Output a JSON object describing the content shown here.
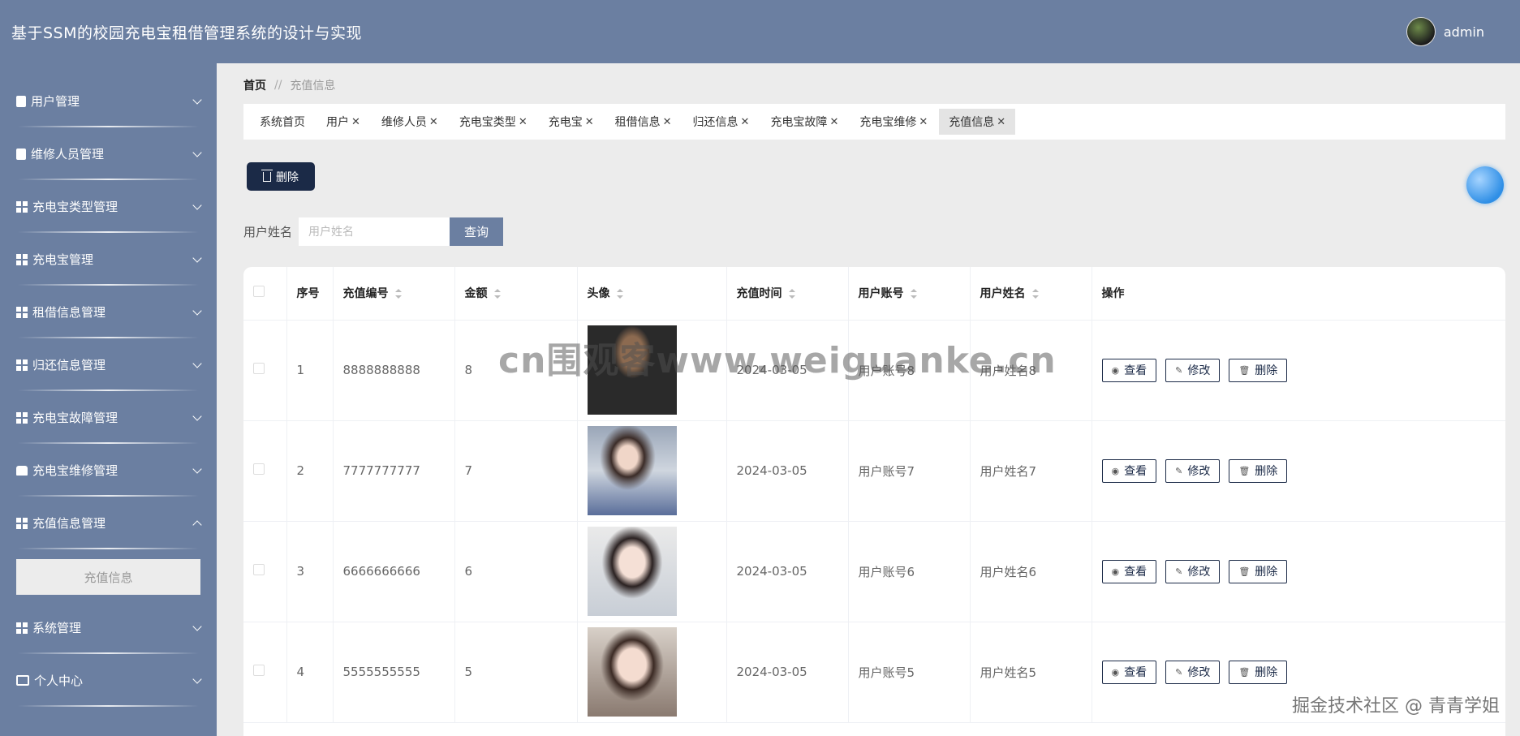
{
  "app": {
    "title": "基于SSM的校园充电宝租借管理系统的设计与实现"
  },
  "user": {
    "name": "admin"
  },
  "sidebar": {
    "items": [
      {
        "label": "用户管理",
        "icon": "clipboard-icon"
      },
      {
        "label": "维修人员管理",
        "icon": "clipboard-check-icon"
      },
      {
        "label": "充电宝类型管理",
        "icon": "grid-icon"
      },
      {
        "label": "充电宝管理",
        "icon": "grid-icon"
      },
      {
        "label": "租借信息管理",
        "icon": "grid-icon"
      },
      {
        "label": "归还信息管理",
        "icon": "grid-icon"
      },
      {
        "label": "充电宝故障管理",
        "icon": "apps-icon"
      },
      {
        "label": "充电宝维修管理",
        "icon": "box-icon"
      },
      {
        "label": "充值信息管理",
        "icon": "grid-icon",
        "expanded": true,
        "children": [
          "充值信息"
        ]
      },
      {
        "label": "系统管理",
        "icon": "grid-icon"
      },
      {
        "label": "个人中心",
        "icon": "card-icon"
      }
    ]
  },
  "breadcrumb": {
    "home": "首页",
    "separator": "//",
    "current": "充值信息"
  },
  "tabs": [
    {
      "label": "系统首页",
      "closable": false
    },
    {
      "label": "用户",
      "closable": true
    },
    {
      "label": "维修人员",
      "closable": true
    },
    {
      "label": "充电宝类型",
      "closable": true
    },
    {
      "label": "充电宝",
      "closable": true
    },
    {
      "label": "租借信息",
      "closable": true
    },
    {
      "label": "归还信息",
      "closable": true
    },
    {
      "label": "充电宝故障",
      "closable": true
    },
    {
      "label": "充电宝维修",
      "closable": true
    },
    {
      "label": "充值信息",
      "closable": true,
      "active": true
    }
  ],
  "toolbar": {
    "delete_label": "删除"
  },
  "search": {
    "label": "用户姓名",
    "placeholder": "用户姓名",
    "button": "查询"
  },
  "table": {
    "columns": [
      "序号",
      "充值编号",
      "金额",
      "头像",
      "充值时间",
      "用户账号",
      "用户姓名",
      "操作"
    ],
    "rows": [
      {
        "index": "1",
        "code": "8888888888",
        "amount": "8",
        "time": "2024-03-05",
        "account": "用户账号8",
        "name": "用户姓名8"
      },
      {
        "index": "2",
        "code": "7777777777",
        "amount": "7",
        "time": "2024-03-05",
        "account": "用户账号7",
        "name": "用户姓名7"
      },
      {
        "index": "3",
        "code": "6666666666",
        "amount": "6",
        "time": "2024-03-05",
        "account": "用户账号6",
        "name": "用户姓名6"
      },
      {
        "index": "4",
        "code": "5555555555",
        "amount": "5",
        "time": "2024-03-05",
        "account": "用户账号5",
        "name": "用户姓名5"
      }
    ],
    "actions": {
      "view": "查看",
      "edit": "修改",
      "delete": "删除"
    }
  },
  "overlay": {
    "watermark": "cn围观客www.weiguanke.cn",
    "credit": "掘金技术社区 @ 青青学姐"
  },
  "colors": {
    "primary": "#6b7fa1",
    "dark": "#1b2a47",
    "background": "#ececec"
  }
}
